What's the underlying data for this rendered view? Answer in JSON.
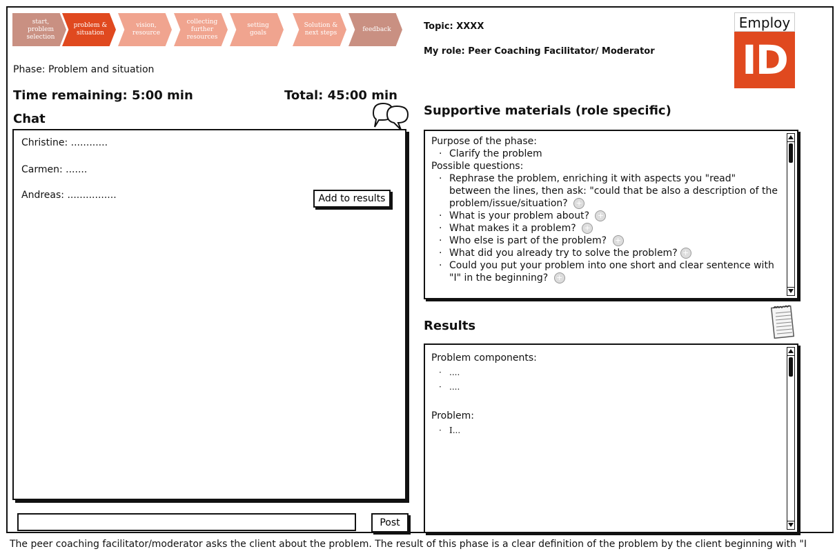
{
  "steps": [
    {
      "label": "start,\nproblem\nselection",
      "color": "#c99082"
    },
    {
      "label": "problem &\nsituation",
      "color": "#e0491f"
    },
    {
      "label": "vision,\nresource",
      "color": "#f0a48f"
    },
    {
      "label": "collecting\nfurther\nresources",
      "color": "#f0a48f"
    },
    {
      "label": "setting\ngoals",
      "color": "#f0a48f"
    },
    {
      "label": "Solution &\nnext steps",
      "color": "#f0a48f"
    },
    {
      "label": "feedback",
      "color": "#c99082"
    }
  ],
  "phase_label": "Phase: Problem and situation",
  "time_remaining": "Time remaining:  5:00 min",
  "total": "Total: 45:00 min",
  "chat": {
    "title": "Chat",
    "messages": [
      {
        "text": "Christine: ............"
      },
      {
        "text": "Carmen: ......."
      },
      {
        "text": "Andreas: ................"
      }
    ],
    "add_button": "Add to results",
    "post_button": "Post",
    "input_value": ""
  },
  "topic": "Topic: XXXX",
  "role": "My role: Peer Coaching Facilitator/ Moderator",
  "logo": {
    "top": "Employ",
    "bottom": "ID",
    "accent": "#e0491f"
  },
  "supportive": {
    "title": "Supportive materials (role specific)",
    "purpose_heading": "Purpose of the phase:",
    "purpose_items": [
      "Clarify the problem"
    ],
    "questions_heading": "Possible questions:",
    "questions": [
      "Rephrase the problem, enriching it with aspects you \"read\" between the lines, then ask: \"could that be also a description of the problem/issue/situation?",
      "What is your problem about?",
      "What makes it a problem?",
      "Who else is part of the problem?",
      "What did you already try to solve the problem?",
      "Could you put your problem into one short and clear sentence with \"I\" in the beginning?"
    ]
  },
  "results": {
    "title": "Results",
    "components_heading": "Problem components:",
    "components": [
      "....",
      "...."
    ],
    "problem_heading": "Problem:",
    "problem_items": [
      "I..."
    ]
  },
  "bottom_text": "The peer coaching facilitator/moderator asks the client about the problem. The result of this phase is a clear definition of the problem by the client beginning with \"I"
}
